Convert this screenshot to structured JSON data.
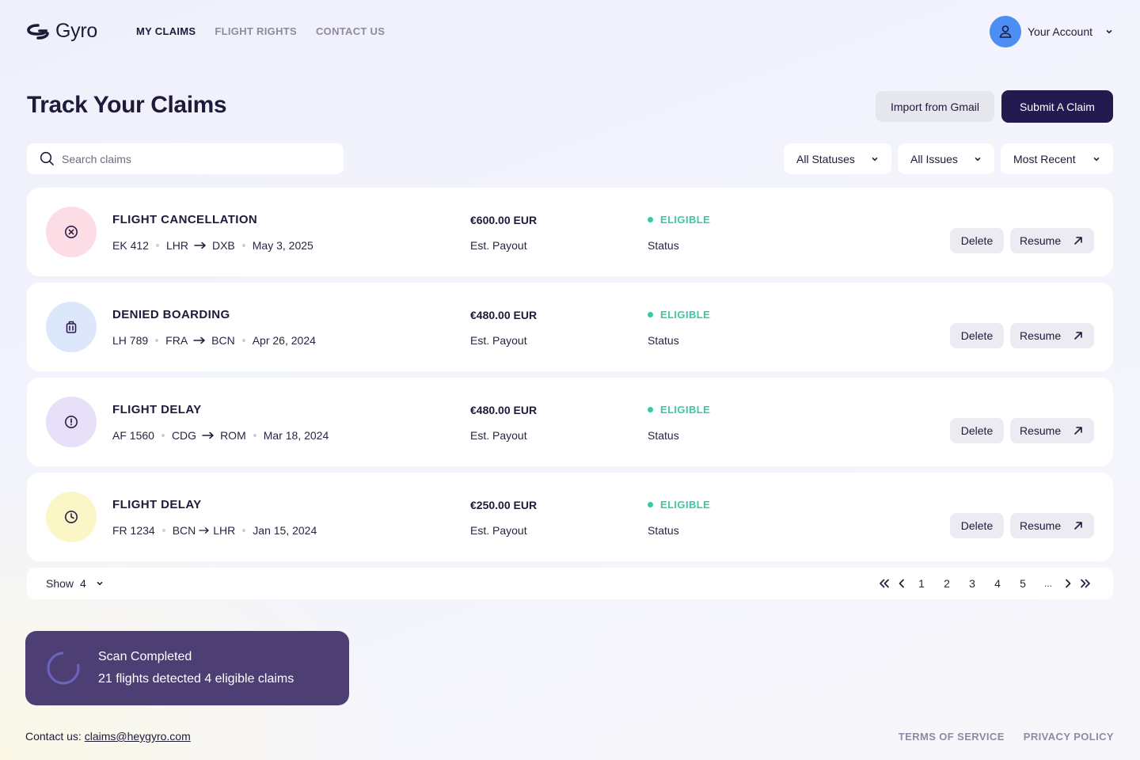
{
  "brand": {
    "name": "Gyro"
  },
  "nav": [
    {
      "label": "MY CLAIMS",
      "active": true
    },
    {
      "label": "FLIGHT RIGHTS",
      "active": false
    },
    {
      "label": "CONTACT US",
      "active": false
    }
  ],
  "account": {
    "label": "Your Account",
    "icon": "user-icon"
  },
  "page": {
    "title": "Track Your Claims"
  },
  "actions": {
    "import_label": "Import from Gmail",
    "submit_label": "Submit A Claim"
  },
  "search": {
    "placeholder": "Search claims",
    "value": ""
  },
  "filters": {
    "status": "All Statuses",
    "issues": "All Issues",
    "sort": "Most Recent"
  },
  "claims": [
    {
      "type": "FLIGHT CANCELLATION",
      "flight": "EK 412",
      "from": "LHR",
      "to": "DXB",
      "date": "May 3, 2025",
      "payout": "€600.00 EUR",
      "payout_label": "Est. Payout",
      "status": "ELIGIBLE",
      "status_label": "Status",
      "icon": "x-circle-icon",
      "icon_bg": "#fcdde6",
      "icon_color": "#2a1d4a",
      "delete_label": "Delete",
      "resume_label": "Resume"
    },
    {
      "type": "DENIED BOARDING",
      "flight": "LH 789",
      "from": "FRA",
      "to": "BCN",
      "date": "Apr 26, 2024",
      "payout": "€480.00 EUR",
      "payout_label": "Est. Payout",
      "status": "ELIGIBLE",
      "status_label": "Status",
      "icon": "luggage-icon",
      "icon_bg": "#dde7fb",
      "icon_color": "#2a1d4a",
      "delete_label": "Delete",
      "resume_label": "Resume"
    },
    {
      "type": "FLIGHT DELAY",
      "flight": "AF 1560",
      "from": "CDG",
      "to": "ROM",
      "date": "Mar 18, 2024",
      "payout": "€480.00 EUR",
      "payout_label": "Est. Payout",
      "status": "ELIGIBLE",
      "status_label": "Status",
      "icon": "alert-circle-icon",
      "icon_bg": "#e7e0f8",
      "icon_color": "#2a1d4a",
      "delete_label": "Delete",
      "resume_label": "Resume"
    },
    {
      "type": "FLIGHT DELAY",
      "flight": "FR 1234",
      "from": "BCN",
      "to": "LHR",
      "date": "Jan 15, 2024",
      "payout": "€250.00 EUR",
      "payout_label": "Est. Payout",
      "status": "ELIGIBLE",
      "status_label": "Status",
      "icon": "clock-icon",
      "icon_bg": "#fbf6c6",
      "icon_color": "#2a1d4a",
      "delete_label": "Delete",
      "resume_label": "Resume"
    }
  ],
  "pagination": {
    "show_label": "Show",
    "show_value": "4",
    "pages": [
      "1",
      "2",
      "3",
      "4",
      "5"
    ],
    "ellipsis": "..."
  },
  "toast": {
    "title": "Scan Completed",
    "message": "21 flights detected 4 eligible claims"
  },
  "footer": {
    "contact_label": "Contact us:",
    "contact_email": "claims@heygyro.com",
    "terms": "TERMS OF SERVICE",
    "privacy": "PRIVACY POLICY"
  },
  "colors": {
    "brand_dark": "#231a50",
    "eligible": "#38c9a6",
    "toast_bg": "#4d3f74",
    "avatar": "#4d8ef5"
  }
}
